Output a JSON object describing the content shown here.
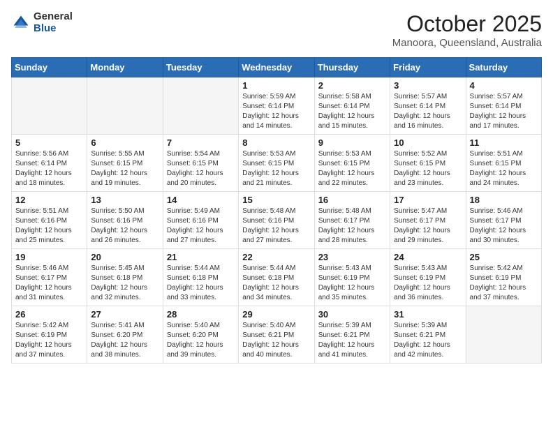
{
  "header": {
    "logo_general": "General",
    "logo_blue": "Blue",
    "month_title": "October 2025",
    "location": "Manoora, Queensland, Australia"
  },
  "days_of_week": [
    "Sunday",
    "Monday",
    "Tuesday",
    "Wednesday",
    "Thursday",
    "Friday",
    "Saturday"
  ],
  "weeks": [
    [
      {
        "day": "",
        "info": ""
      },
      {
        "day": "",
        "info": ""
      },
      {
        "day": "",
        "info": ""
      },
      {
        "day": "1",
        "info": "Sunrise: 5:59 AM\nSunset: 6:14 PM\nDaylight: 12 hours\nand 14 minutes."
      },
      {
        "day": "2",
        "info": "Sunrise: 5:58 AM\nSunset: 6:14 PM\nDaylight: 12 hours\nand 15 minutes."
      },
      {
        "day": "3",
        "info": "Sunrise: 5:57 AM\nSunset: 6:14 PM\nDaylight: 12 hours\nand 16 minutes."
      },
      {
        "day": "4",
        "info": "Sunrise: 5:57 AM\nSunset: 6:14 PM\nDaylight: 12 hours\nand 17 minutes."
      }
    ],
    [
      {
        "day": "5",
        "info": "Sunrise: 5:56 AM\nSunset: 6:14 PM\nDaylight: 12 hours\nand 18 minutes."
      },
      {
        "day": "6",
        "info": "Sunrise: 5:55 AM\nSunset: 6:15 PM\nDaylight: 12 hours\nand 19 minutes."
      },
      {
        "day": "7",
        "info": "Sunrise: 5:54 AM\nSunset: 6:15 PM\nDaylight: 12 hours\nand 20 minutes."
      },
      {
        "day": "8",
        "info": "Sunrise: 5:53 AM\nSunset: 6:15 PM\nDaylight: 12 hours\nand 21 minutes."
      },
      {
        "day": "9",
        "info": "Sunrise: 5:53 AM\nSunset: 6:15 PM\nDaylight: 12 hours\nand 22 minutes."
      },
      {
        "day": "10",
        "info": "Sunrise: 5:52 AM\nSunset: 6:15 PM\nDaylight: 12 hours\nand 23 minutes."
      },
      {
        "day": "11",
        "info": "Sunrise: 5:51 AM\nSunset: 6:15 PM\nDaylight: 12 hours\nand 24 minutes."
      }
    ],
    [
      {
        "day": "12",
        "info": "Sunrise: 5:51 AM\nSunset: 6:16 PM\nDaylight: 12 hours\nand 25 minutes."
      },
      {
        "day": "13",
        "info": "Sunrise: 5:50 AM\nSunset: 6:16 PM\nDaylight: 12 hours\nand 26 minutes."
      },
      {
        "day": "14",
        "info": "Sunrise: 5:49 AM\nSunset: 6:16 PM\nDaylight: 12 hours\nand 27 minutes."
      },
      {
        "day": "15",
        "info": "Sunrise: 5:48 AM\nSunset: 6:16 PM\nDaylight: 12 hours\nand 27 minutes."
      },
      {
        "day": "16",
        "info": "Sunrise: 5:48 AM\nSunset: 6:17 PM\nDaylight: 12 hours\nand 28 minutes."
      },
      {
        "day": "17",
        "info": "Sunrise: 5:47 AM\nSunset: 6:17 PM\nDaylight: 12 hours\nand 29 minutes."
      },
      {
        "day": "18",
        "info": "Sunrise: 5:46 AM\nSunset: 6:17 PM\nDaylight: 12 hours\nand 30 minutes."
      }
    ],
    [
      {
        "day": "19",
        "info": "Sunrise: 5:46 AM\nSunset: 6:17 PM\nDaylight: 12 hours\nand 31 minutes."
      },
      {
        "day": "20",
        "info": "Sunrise: 5:45 AM\nSunset: 6:18 PM\nDaylight: 12 hours\nand 32 minutes."
      },
      {
        "day": "21",
        "info": "Sunrise: 5:44 AM\nSunset: 6:18 PM\nDaylight: 12 hours\nand 33 minutes."
      },
      {
        "day": "22",
        "info": "Sunrise: 5:44 AM\nSunset: 6:18 PM\nDaylight: 12 hours\nand 34 minutes."
      },
      {
        "day": "23",
        "info": "Sunrise: 5:43 AM\nSunset: 6:19 PM\nDaylight: 12 hours\nand 35 minutes."
      },
      {
        "day": "24",
        "info": "Sunrise: 5:43 AM\nSunset: 6:19 PM\nDaylight: 12 hours\nand 36 minutes."
      },
      {
        "day": "25",
        "info": "Sunrise: 5:42 AM\nSunset: 6:19 PM\nDaylight: 12 hours\nand 37 minutes."
      }
    ],
    [
      {
        "day": "26",
        "info": "Sunrise: 5:42 AM\nSunset: 6:19 PM\nDaylight: 12 hours\nand 37 minutes."
      },
      {
        "day": "27",
        "info": "Sunrise: 5:41 AM\nSunset: 6:20 PM\nDaylight: 12 hours\nand 38 minutes."
      },
      {
        "day": "28",
        "info": "Sunrise: 5:40 AM\nSunset: 6:20 PM\nDaylight: 12 hours\nand 39 minutes."
      },
      {
        "day": "29",
        "info": "Sunrise: 5:40 AM\nSunset: 6:21 PM\nDaylight: 12 hours\nand 40 minutes."
      },
      {
        "day": "30",
        "info": "Sunrise: 5:39 AM\nSunset: 6:21 PM\nDaylight: 12 hours\nand 41 minutes."
      },
      {
        "day": "31",
        "info": "Sunrise: 5:39 AM\nSunset: 6:21 PM\nDaylight: 12 hours\nand 42 minutes."
      },
      {
        "day": "",
        "info": ""
      }
    ]
  ]
}
